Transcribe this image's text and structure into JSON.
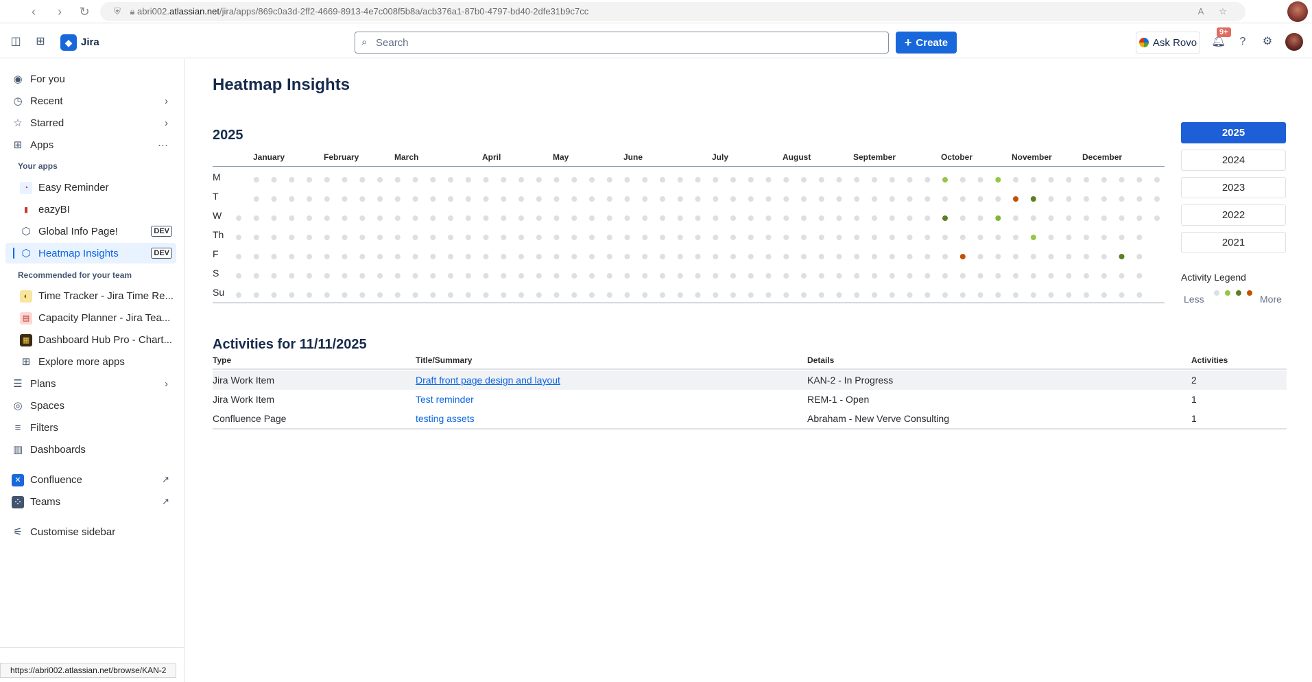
{
  "browser": {
    "url_prefix": "abri002.",
    "url_domain": "atlassian.net",
    "url_path": "/jira/apps/869c0a3d-2ff2-4669-8913-4e7c008f5b8a/acb376a1-87b0-4797-bd40-2dfe31b9c7cc",
    "status_url": "https://abri002.atlassian.net/browse/KAN-2"
  },
  "topnav": {
    "app_name": "Jira",
    "search_placeholder": "Search",
    "create_label": "Create",
    "ask_rovo_label": "Ask Rovo",
    "notification_badge": "9+"
  },
  "sidebar": {
    "for_you": "For you",
    "recent": "Recent",
    "starred": "Starred",
    "apps": "Apps",
    "your_apps_heading": "Your apps",
    "your_apps": [
      {
        "label": "Easy Reminder"
      },
      {
        "label": "eazyBI"
      },
      {
        "label": "Global Info Page!",
        "tag": "DEV"
      },
      {
        "label": "Heatmap Insights",
        "tag": "DEV"
      }
    ],
    "recommended_heading": "Recommended for your team",
    "recommended": [
      {
        "label": "Time Tracker - Jira Time Re..."
      },
      {
        "label": "Capacity Planner - Jira Tea..."
      },
      {
        "label": "Dashboard Hub Pro - Chart..."
      }
    ],
    "explore": "Explore more apps",
    "plans": "Plans",
    "spaces": "Spaces",
    "filters": "Filters",
    "dashboards": "Dashboards",
    "confluence": "Confluence",
    "teams": "Teams",
    "customise": "Customise sidebar"
  },
  "page": {
    "title": "Heatmap Insights",
    "year": "2025",
    "months": [
      "January",
      "February",
      "March",
      "April",
      "May",
      "June",
      "July",
      "August",
      "September",
      "October",
      "November",
      "December"
    ],
    "days": [
      "M",
      "T",
      "W",
      "Th",
      "F",
      "S",
      "Su"
    ],
    "year_buttons": [
      "2025",
      "2024",
      "2023",
      "2022",
      "2021"
    ],
    "legend_title": "Activity Legend",
    "legend_less": "Less",
    "legend_more": "More",
    "activities_title": "Activities for 11/11/2025",
    "table_headers": [
      "Type",
      "Title/Summary",
      "Details",
      "Activities"
    ],
    "table_rows": [
      {
        "type": "Jira Work Item",
        "title": "Draft front page design and layout",
        "details": "KAN-2 - In Progress",
        "activities": "2"
      },
      {
        "type": "Jira Work Item",
        "title": "Test reminder",
        "details": "REM-1 - Open",
        "activities": "1"
      },
      {
        "type": "Confluence Page",
        "title": "testing assets",
        "details": "Abraham - New Verve Consulting",
        "activities": "1"
      }
    ]
  },
  "heatmap": {
    "year": 2025,
    "first_day": "Wednesday",
    "levels": [
      "none",
      "level-1",
      "level-2",
      "level-3",
      "level-4"
    ],
    "colors": {
      "none": "#dcdfe4",
      "level-1": "#94c748",
      "level-2": "#82b536",
      "level-3": "#5b7f24",
      "level-4": "#c25100"
    },
    "active_days": [
      {
        "date": "2025-10-06",
        "level": 1
      },
      {
        "date": "2025-10-08",
        "level": 3
      },
      {
        "date": "2025-10-17",
        "level": 4
      },
      {
        "date": "2025-10-27",
        "level": 1
      },
      {
        "date": "2025-10-29",
        "level": 2
      },
      {
        "date": "2025-11-04",
        "level": 4
      },
      {
        "date": "2025-11-11",
        "level": 3
      },
      {
        "date": "2025-11-13",
        "level": 1
      },
      {
        "date": "2025-12-19",
        "level": 3
      }
    ]
  }
}
